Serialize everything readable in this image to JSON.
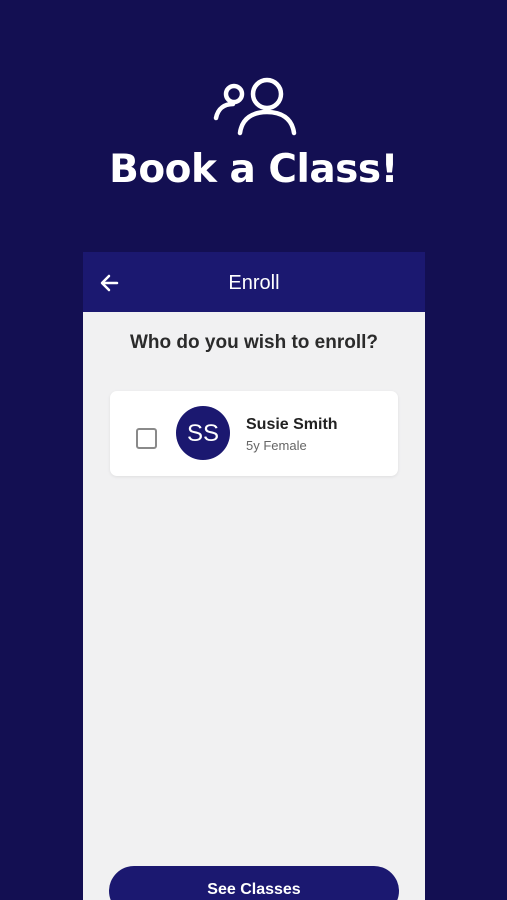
{
  "hero": {
    "icon": "people-icon",
    "title": "Book a Class!"
  },
  "appbar": {
    "back_icon": "arrow-left-icon",
    "title": "Enroll"
  },
  "enroll": {
    "question": "Who do you wish to enroll?",
    "people": [
      {
        "initials": "SS",
        "name": "Susie Smith",
        "meta": "5y Female",
        "checked": false
      }
    ]
  },
  "footer": {
    "cta_label": "See Classes"
  },
  "colors": {
    "background": "#130f52",
    "brand": "#1b1870",
    "surface": "#f1f1f2",
    "card": "#ffffff"
  }
}
